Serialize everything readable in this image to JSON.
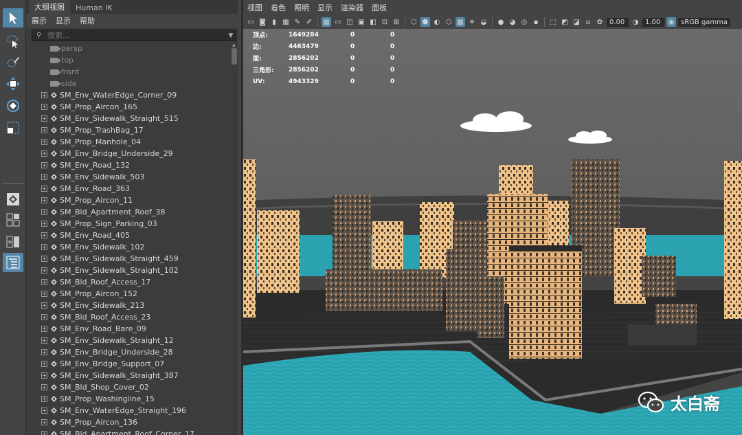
{
  "colors": {
    "panel_bg": "#444444",
    "outliner_bg": "#3c3c3c",
    "accent_blue": "#5285a6",
    "sky": "#707070",
    "water": "#2ba3b0",
    "building_light": "#f2c58a",
    "ground": "#2a2a2a"
  },
  "toolbox": {
    "tools": [
      {
        "name": "select-tool-icon",
        "active": true
      },
      {
        "name": "lasso-tool-icon",
        "active": false
      },
      {
        "name": "paint-select-tool-icon",
        "active": false
      },
      {
        "name": "move-tool-icon",
        "active": false
      },
      {
        "name": "rotate-tool-icon",
        "active": false
      },
      {
        "name": "scale-tool-icon",
        "active": false
      }
    ],
    "layouts": [
      {
        "name": "single-view-layout-icon",
        "active": false
      },
      {
        "name": "four-view-layout-icon",
        "active": false
      },
      {
        "name": "two-view-layout-icon",
        "active": false
      },
      {
        "name": "outliner-layout-icon",
        "active": true
      }
    ]
  },
  "outliner": {
    "tabs": [
      "大纲视图",
      "Human IK"
    ],
    "menu": [
      "展示",
      "显示",
      "帮助"
    ],
    "search_placeholder": "搜索...",
    "cameras": [
      "persp",
      "top",
      "front",
      "side"
    ],
    "objects": [
      "SM_Env_WaterEdge_Corner_09",
      "SM_Prop_Aircon_165",
      "SM_Env_Sidewalk_Straight_515",
      "SM_Prop_TrashBag_17",
      "SM_Prop_Manhole_04",
      "SM_Env_Bridge_Underside_29",
      "SM_Env_Road_132",
      "SM_Env_Sidewalk_503",
      "SM_Env_Road_363",
      "SM_Prop_Aircon_11",
      "SM_Bld_Apartment_Roof_38",
      "SM_Prop_Sign_Parking_03",
      "SM_Env_Road_405",
      "SM_Env_Sidewalk_102",
      "SM_Env_Sidewalk_Straight_459",
      "SM_Env_Sidewalk_Straight_102",
      "SM_Bld_Roof_Access_17",
      "SM_Prop_Aircon_152",
      "SM_Env_Sidewalk_213",
      "SM_Bld_Roof_Access_23",
      "SM_Env_Road_Bare_09",
      "SM_Env_Sidewalk_Straight_12",
      "SM_Env_Bridge_Underside_28",
      "SM_Env_Bridge_Support_07",
      "SM_Env_Sidewalk_Straight_387",
      "SM_Bld_Shop_Cover_02",
      "SM_Prop_Washingline_15",
      "SM_Env_WaterEdge_Straight_196",
      "SM_Prop_Aircon_136",
      "SM_Bld_Apartment_Roof_Corner_17"
    ]
  },
  "viewport": {
    "menu": [
      "视图",
      "着色",
      "照明",
      "显示",
      "渲染器",
      "面板"
    ],
    "toolbar": {
      "exposure": "0.00",
      "gamma": "1.00",
      "color_space": "sRGB gamma"
    },
    "hud": [
      {
        "label": "顶点:",
        "v1": "1649284",
        "v2": "0",
        "v3": "0"
      },
      {
        "label": "边:",
        "v1": "4463479",
        "v2": "0",
        "v3": "0"
      },
      {
        "label": "面:",
        "v1": "2856202",
        "v2": "0",
        "v3": "0"
      },
      {
        "label": "三角形:",
        "v1": "2856202",
        "v2": "0",
        "v3": "0"
      },
      {
        "label": "UV:",
        "v1": "4943329",
        "v2": "0",
        "v3": "0"
      }
    ]
  },
  "watermark": {
    "text": "太白斋",
    "icon": "wechat-icon"
  }
}
